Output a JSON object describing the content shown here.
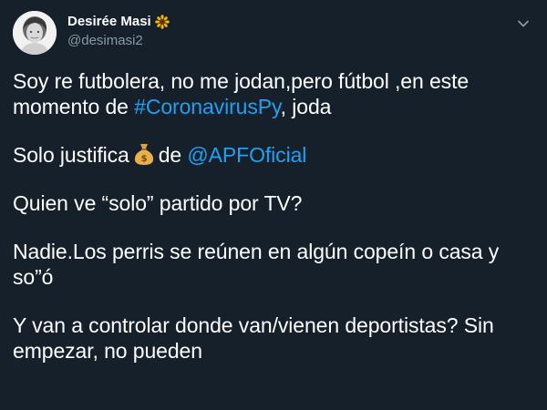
{
  "tweet": {
    "author": {
      "display_name": "Desirée Masi",
      "handle": "@desimasi2",
      "name_emoji_icon": "sunflower-icon",
      "avatar_icon": "profile-photo"
    },
    "menu_icon": "chevron-down-icon",
    "paragraphs": [
      {
        "text_before": "Soy re futbolera, no me jodan,pero fútbol ,en este momento de ",
        "link": "#CoronavirusPy",
        "text_after": ", joda"
      },
      {
        "text_before": "Solo justifica",
        "emoji_icon": "money-bag-icon",
        "text_middle": "de ",
        "link": "@APFOficial"
      },
      {
        "text": "Quien ve “solo” partido por TV?"
      },
      {
        "text": "Nadie.Los perris se reúnen en algún copeín o casa y so”ó"
      },
      {
        "text": "Y van a controlar donde van/vienen deportistas? Sin empezar, no pueden"
      }
    ]
  },
  "colors": {
    "background": "#15202b",
    "text": "#ffffff",
    "secondary_text": "#8899a6",
    "link": "#1da1f2"
  }
}
